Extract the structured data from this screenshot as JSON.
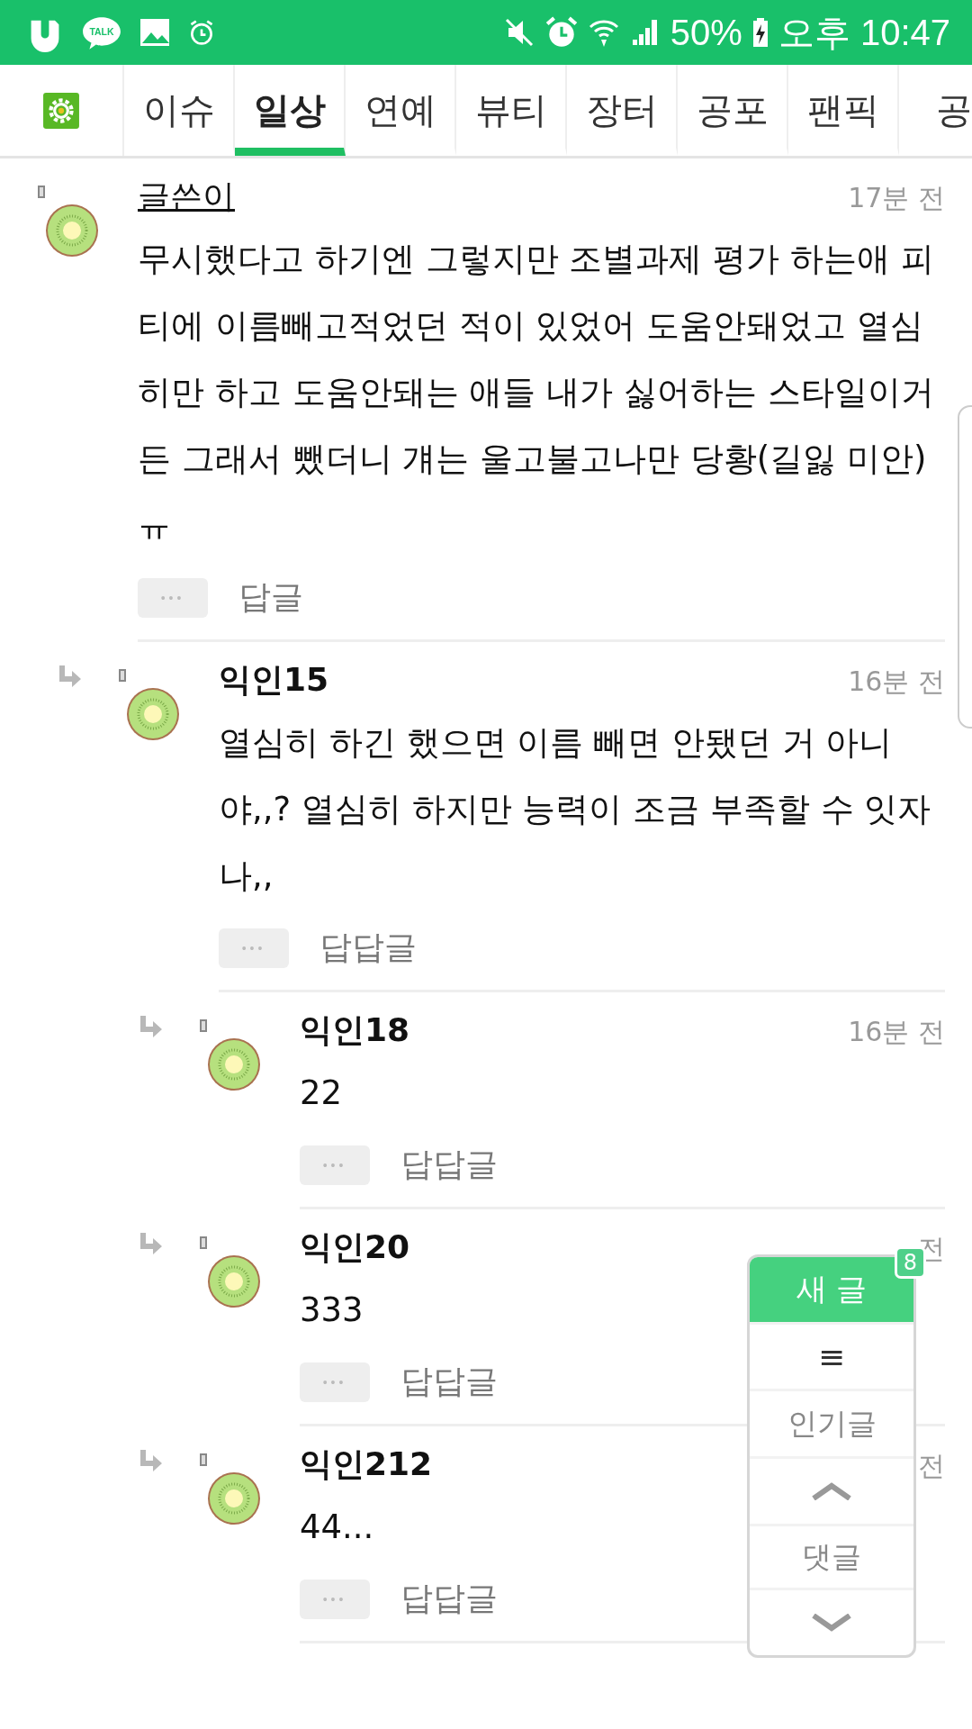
{
  "status_bar": {
    "talk_label": "TALK",
    "battery": "50%",
    "time": "오후 10:47"
  },
  "tabs": [
    {
      "label": "이슈",
      "selected": false
    },
    {
      "label": "일상",
      "selected": true
    },
    {
      "label": "연예",
      "selected": false
    },
    {
      "label": "뷰티",
      "selected": false
    },
    {
      "label": "장터",
      "selected": false
    },
    {
      "label": "공포",
      "selected": false
    },
    {
      "label": "팬픽",
      "selected": false
    },
    {
      "label": "공",
      "selected": false
    }
  ],
  "comments": [
    {
      "name": "글쓴이",
      "author": true,
      "time": "17분 전",
      "body": "무시했다고 하기엔 그렇지만 조별과제 평가 하는애 피티에 이름빼고적었던 적이 있었어 도움안돼었고 열심히만 하고 도움안돼는 애들 내가 싫어하는 스타일이거든 그래서 뺐더니 걔는 울고불고나만 당황(길잃 미안)ㅠ",
      "more": "•••",
      "reply": "답글",
      "children": [
        {
          "name": "익인15",
          "author": false,
          "time": "16분 전",
          "body": "열심히 하긴 했으면 이름 빼면 안됐던 거 아니야,,? 열심히 하지만 능력이 조금 부족할 수 잇자나,,",
          "more": "•••",
          "reply": "답답글",
          "children": [
            {
              "name": "익인18",
              "author": false,
              "time": "16분 전",
              "body": "22",
              "more": "•••",
              "reply": "답답글"
            },
            {
              "name": "익인20",
              "author": false,
              "time": "전",
              "body": "333",
              "more": "•••",
              "reply": "답답글"
            },
            {
              "name": "익인212",
              "author": false,
              "time": "전",
              "body": "44...",
              "more": "•••",
              "reply": "답답글"
            }
          ]
        }
      ]
    }
  ],
  "floating_menu": {
    "new_post": "새 글",
    "new_count": "8",
    "menu": "≡",
    "popular": "인기글",
    "comments": "댓글"
  }
}
